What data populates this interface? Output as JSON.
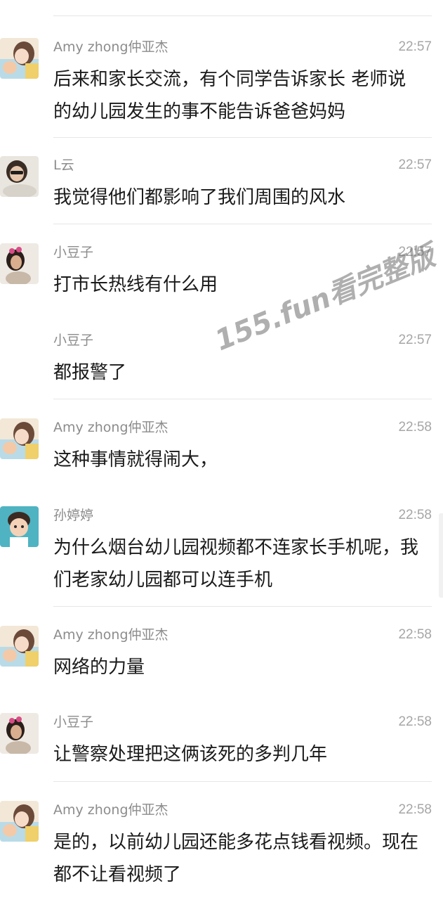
{
  "messages": [
    {
      "sender": "Amy zhong仲亚杰",
      "time": "22:57",
      "text": "后来和家长交流，有个同学告诉家长 老师说的幼儿园发生的事不能告诉爸爸妈妈",
      "avatar_icon": "amy-avatar-icon"
    },
    {
      "sender": "L云",
      "time": "22:57",
      "text": "我觉得他们都影响了我们周围的风水",
      "avatar_icon": "l-yun-avatar-icon"
    },
    {
      "sender": "小豆子",
      "time": "22:57",
      "text": "打市长热线有什么用",
      "avatar_icon": "xiaodouzi-avatar-icon"
    },
    {
      "sender": "小豆子",
      "time": "22:57",
      "text": "都报警了",
      "avatar_icon": ""
    },
    {
      "sender": "Amy zhong仲亚杰",
      "time": "22:58",
      "text": "这种事情就得闹大，",
      "avatar_icon": "amy-avatar-icon"
    },
    {
      "sender": "孙婷婷",
      "time": "22:58",
      "text": "为什么烟台幼儿园视频都不连家长手机呢，我们老家幼儿园都可以连手机",
      "avatar_icon": "sun-tingting-avatar-icon"
    },
    {
      "sender": "Amy zhong仲亚杰",
      "time": "22:58",
      "text": "网络的力量",
      "avatar_icon": "amy-avatar-icon"
    },
    {
      "sender": "小豆子",
      "time": "22:58",
      "text": "让警察处理把这俩该死的多判几年",
      "avatar_icon": "xiaodouzi-avatar-icon"
    },
    {
      "sender": "Amy zhong仲亚杰",
      "time": "22:58",
      "text": "是的，以前幼儿园还能多花点钱看视频。现在都不让看视频了",
      "avatar_icon": "amy-avatar-icon"
    }
  ],
  "watermark": "155.fun看完整版",
  "colors": {
    "sender_text": "#8c8c8c",
    "time_text": "#a6a6a6",
    "message_text": "#1a1a1a",
    "divider": "#e6e6e6"
  }
}
